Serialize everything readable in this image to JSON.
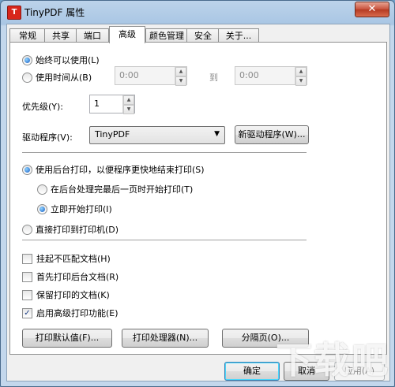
{
  "window": {
    "title": "TinyPDF 属性",
    "icon_glyph": "T",
    "close_glyph": "✕"
  },
  "tabs": [
    "常规",
    "共享",
    "端口",
    "高级",
    "颜色管理",
    "安全",
    "关于..."
  ],
  "availability": {
    "always_label": "始终可以使用(L)",
    "from_label": "使用时间从(B)",
    "from_time": "0:00",
    "to_label": "到",
    "to_time": "0:00"
  },
  "priority": {
    "label": "优先级(Y):",
    "value": "1"
  },
  "driver": {
    "label": "驱动程序(V):",
    "value": "TinyPDF",
    "new_driver_button": "新驱动程序(W)..."
  },
  "spooling": {
    "spool_label": "使用后台打印，以便程序更快地结束打印(S)",
    "after_last_page_label": "在后台处理完最后一页时开始打印(T)",
    "immediately_label": "立即开始打印(I)",
    "direct_label": "直接打印到打印机(D)"
  },
  "options": [
    {
      "label": "挂起不匹配文档(H)",
      "checked": false
    },
    {
      "label": "首先打印后台文档(R)",
      "checked": false
    },
    {
      "label": "保留打印的文档(K)",
      "checked": false
    },
    {
      "label": "启用高级打印功能(E)",
      "checked": true
    }
  ],
  "bottom_buttons": {
    "defaults": "打印默认值(F)...",
    "processor": "打印处理器(N)...",
    "separator_page": "分隔页(O)..."
  },
  "dialog_buttons": {
    "ok": "确定",
    "cancel": "取消",
    "apply": "应用(A)"
  },
  "watermark": "下载吧"
}
